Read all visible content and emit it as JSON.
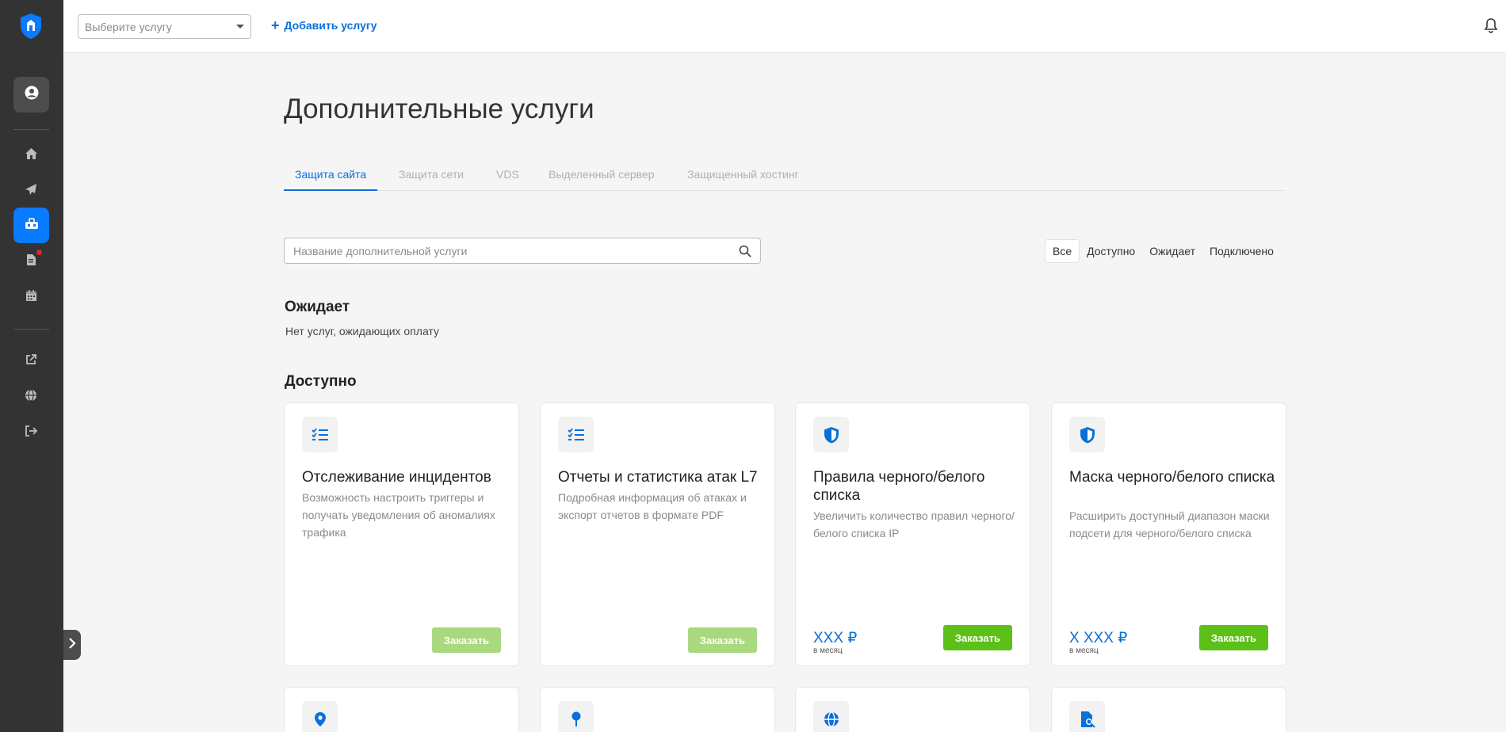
{
  "sidebar": {
    "logo_icon": "shield-logo-icon",
    "items": [
      {
        "name": "profile",
        "icon": "user-circle-icon"
      },
      {
        "name": "home",
        "icon": "home-icon"
      },
      {
        "name": "send",
        "icon": "paper-plane-icon"
      },
      {
        "name": "services",
        "icon": "toolbox-icon",
        "active": true
      },
      {
        "name": "documents",
        "icon": "document-icon",
        "notification": true
      },
      {
        "name": "calendar",
        "icon": "calendar-icon"
      },
      {
        "name": "external",
        "icon": "external-link-icon"
      },
      {
        "name": "language",
        "icon": "globe-icon"
      },
      {
        "name": "logout",
        "icon": "logout-icon"
      }
    ],
    "collapse_icon": "chevron-right-icon"
  },
  "topbar": {
    "service_select_placeholder": "Выберите услугу",
    "add_service_label": "Добавить услугу",
    "bell_icon": "bell-icon"
  },
  "page": {
    "title": "Дополнительные услуги"
  },
  "tabs": [
    {
      "label": "Защита сайта",
      "active": true
    },
    {
      "label": "Защита сети"
    },
    {
      "label": "VDS"
    },
    {
      "label": "Выделенный сервер"
    },
    {
      "label": "Защищенный хостинг"
    }
  ],
  "search": {
    "placeholder": "Название дополнительной услуги",
    "value": ""
  },
  "filters": [
    {
      "label": "Все",
      "active": true
    },
    {
      "label": "Доступно"
    },
    {
      "label": "Ожидает"
    },
    {
      "label": "Подключено"
    }
  ],
  "sections": {
    "pending_title": "Ожидает",
    "pending_empty": "Нет услуг, ожидающих оплату",
    "available_title": "Доступно"
  },
  "cards": [
    {
      "icon": "checklist-icon",
      "title": "Отслеживание инцидентов",
      "description": "Возможность настроить триггеры и получать уведомления об аномалиях трафика",
      "button": "Заказать",
      "disabled": true
    },
    {
      "icon": "checklist-icon",
      "title": "Отчеты и статистика атак L7",
      "description": "Подробная информация об атаках и экспорт отчетов в формате PDF",
      "button": "Заказать",
      "disabled": true
    },
    {
      "icon": "shield-icon",
      "title": "Правила черного/белого списка",
      "description": "Увеличить количество правил черного/белого списка IP",
      "price": "XXX ₽",
      "price_note": "в месяц",
      "button": "Заказать",
      "disabled": false
    },
    {
      "icon": "shield-icon",
      "title": "Маска черного/белого списка",
      "description": "Расширить доступный диапазон маски подсети для черного/белого списка",
      "price": "X XXX ₽",
      "price_note": "в месяц",
      "button": "Заказать",
      "disabled": false
    }
  ],
  "next_row_icons": [
    "map-marker-icon",
    "pin-icon",
    "globe-icon",
    "file-search-icon"
  ],
  "colors": {
    "sidebar_bg": "#333333",
    "accent_blue": "#0a7aff",
    "link_blue": "#0a6fd8",
    "order_green": "#5cc019",
    "order_green_disabled": "#a8d97e",
    "notification_red": "#e0262b"
  }
}
